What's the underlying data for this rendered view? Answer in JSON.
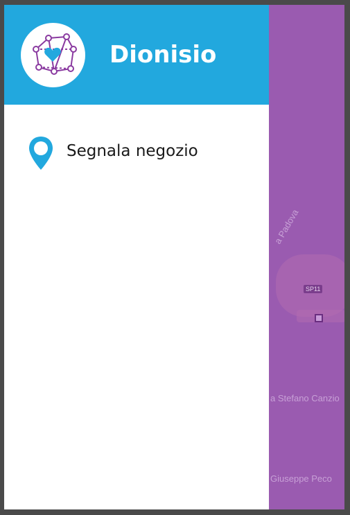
{
  "app": {
    "title": "Dionisio"
  },
  "drawer": {
    "items": [
      {
        "label": "Segnala negozio",
        "icon": "map-pin-icon"
      }
    ]
  },
  "map": {
    "labels": {
      "road_padova": "a Padova",
      "shield": "SP11",
      "street_1": "a Stefano Canzio",
      "street_2": "Giuseppe Peco"
    }
  },
  "colors": {
    "header": "#22a8de",
    "map_overlay": "#9a5bb0",
    "accent_icon": "#22a8de"
  }
}
